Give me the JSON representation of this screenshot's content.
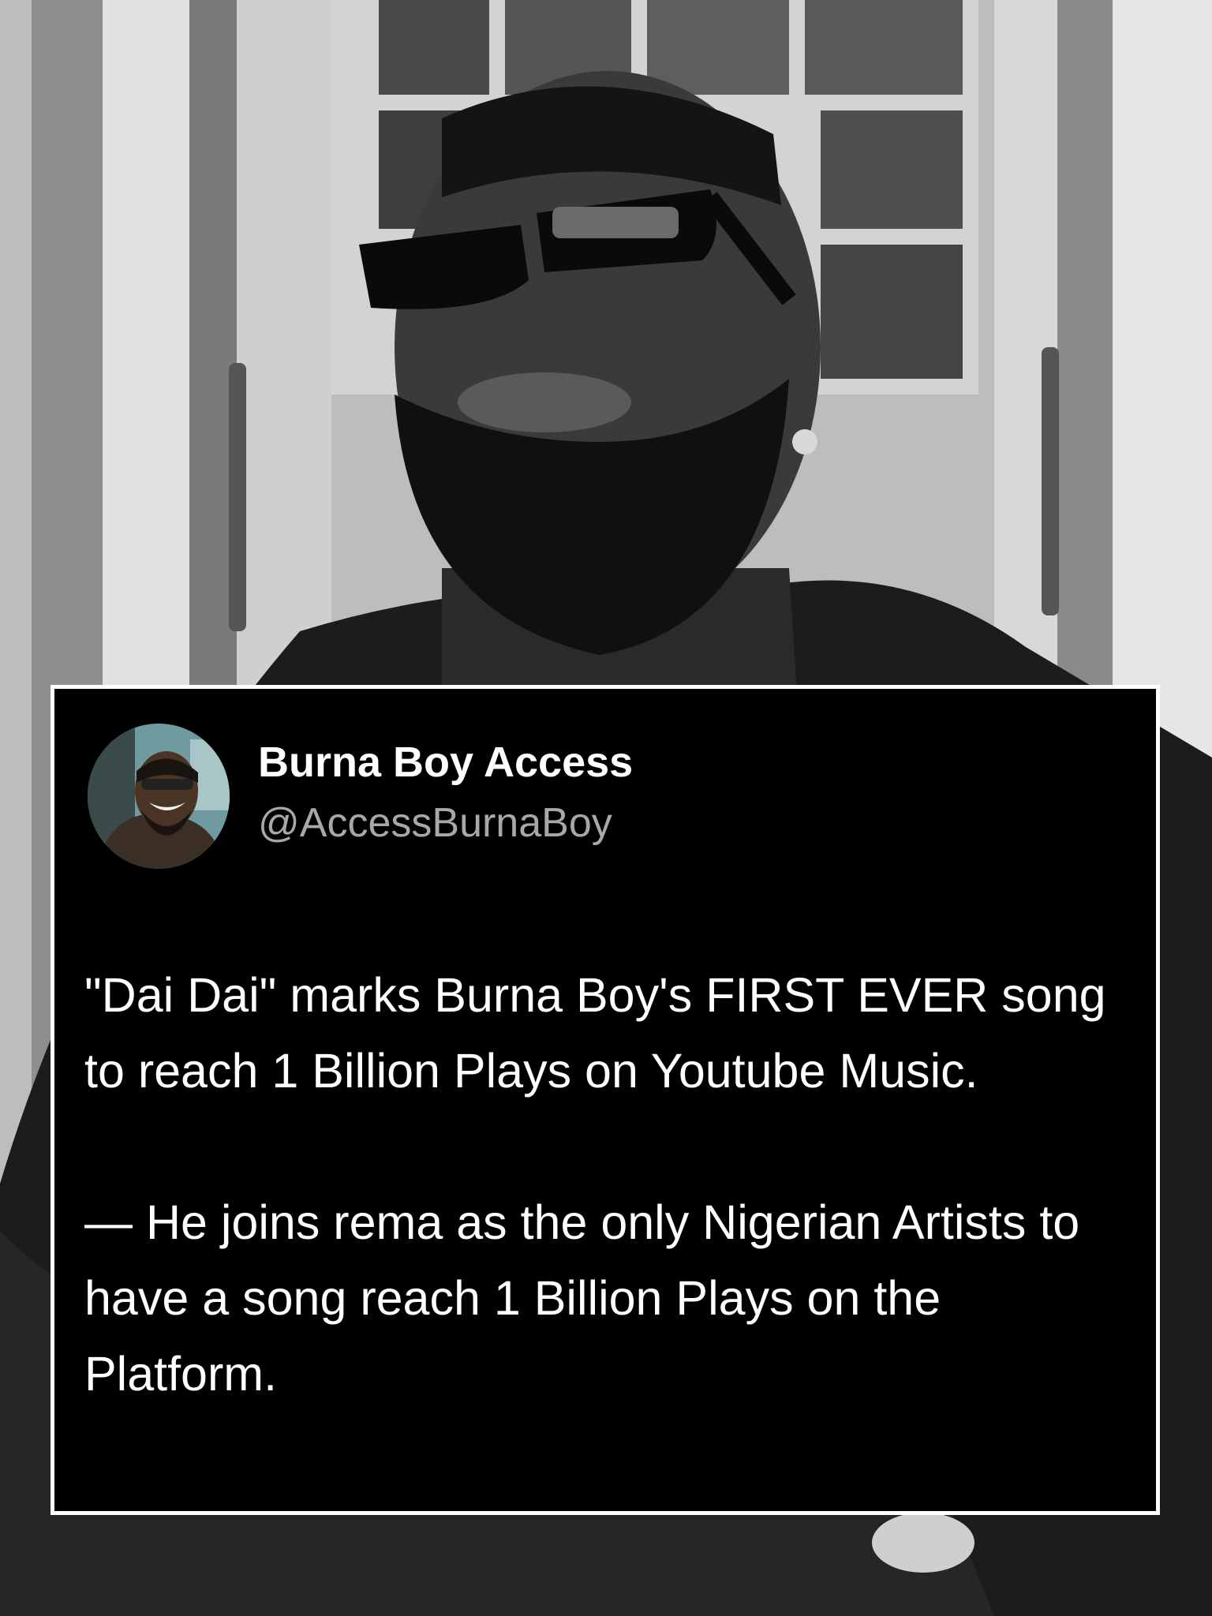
{
  "tweet": {
    "display_name": "Burna Boy Access",
    "handle": "@AccessBurnaBoy",
    "paragraphs": [
      "\"Dai Dai\" marks Burna Boy's FIRST EVER song to reach 1 Billion Plays on Youtube Music.",
      "— He joins rema as the only Nigerian Artists to have a song reach 1 Billion Plays on the Platform."
    ]
  },
  "background": {
    "description_icon": "monochrome-portrait-photo",
    "tone": "black-and-white"
  },
  "colors": {
    "card_background": "#000000",
    "card_border": "#ffffff",
    "name_text": "#ffffff",
    "handle_text": "#a8a8a8",
    "body_text": "#ffffff"
  }
}
